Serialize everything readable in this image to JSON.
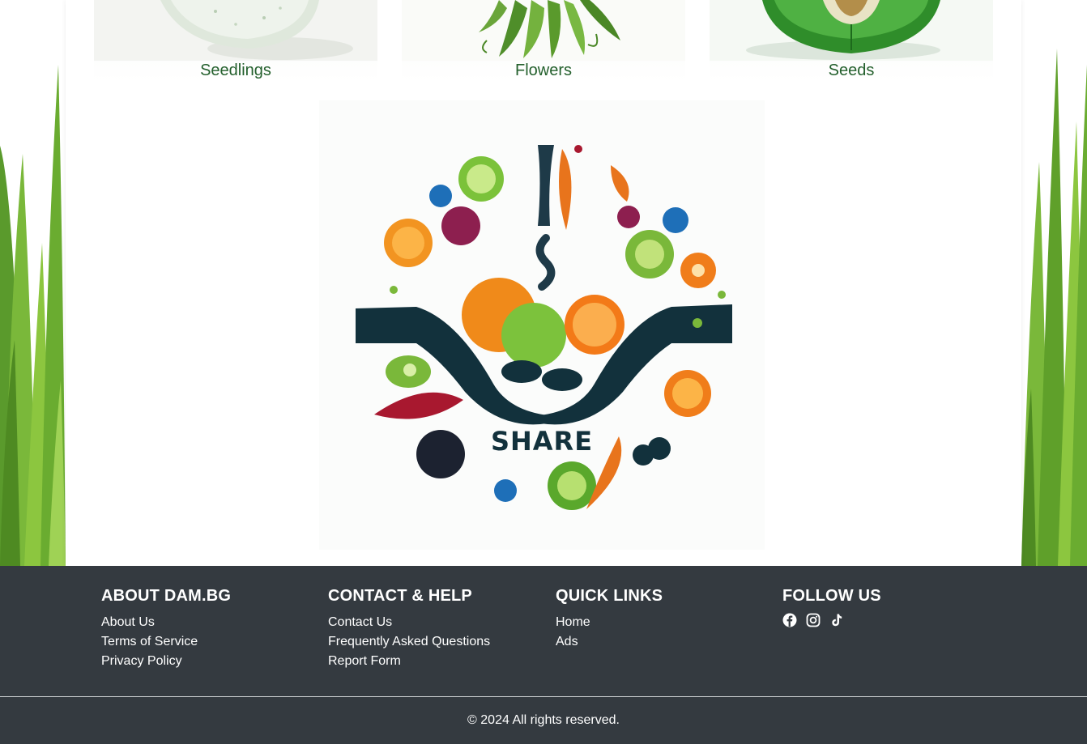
{
  "categories": [
    {
      "label": "Seedlings"
    },
    {
      "label": "Flowers"
    },
    {
      "label": "Seeds"
    }
  ],
  "logo": {
    "text": "SHARE"
  },
  "footer": {
    "about": {
      "title": "ABOUT DAM.BG",
      "links": [
        "About Us",
        "Terms of Service",
        "Privacy Policy"
      ]
    },
    "contact": {
      "title": "CONTACT & HELP",
      "links": [
        "Contact Us",
        "Frequently Asked Questions",
        "Report Form"
      ]
    },
    "quick": {
      "title": "QUICK LINKS",
      "links": [
        "Home",
        "Ads"
      ]
    },
    "follow": {
      "title": "FOLLOW US",
      "icons": [
        "facebook-icon",
        "instagram-icon",
        "tiktok-icon"
      ]
    },
    "copyright": "© 2024 All rights reserved."
  },
  "colors": {
    "footer_bg": "#343a40",
    "label_green": "#24602d"
  }
}
